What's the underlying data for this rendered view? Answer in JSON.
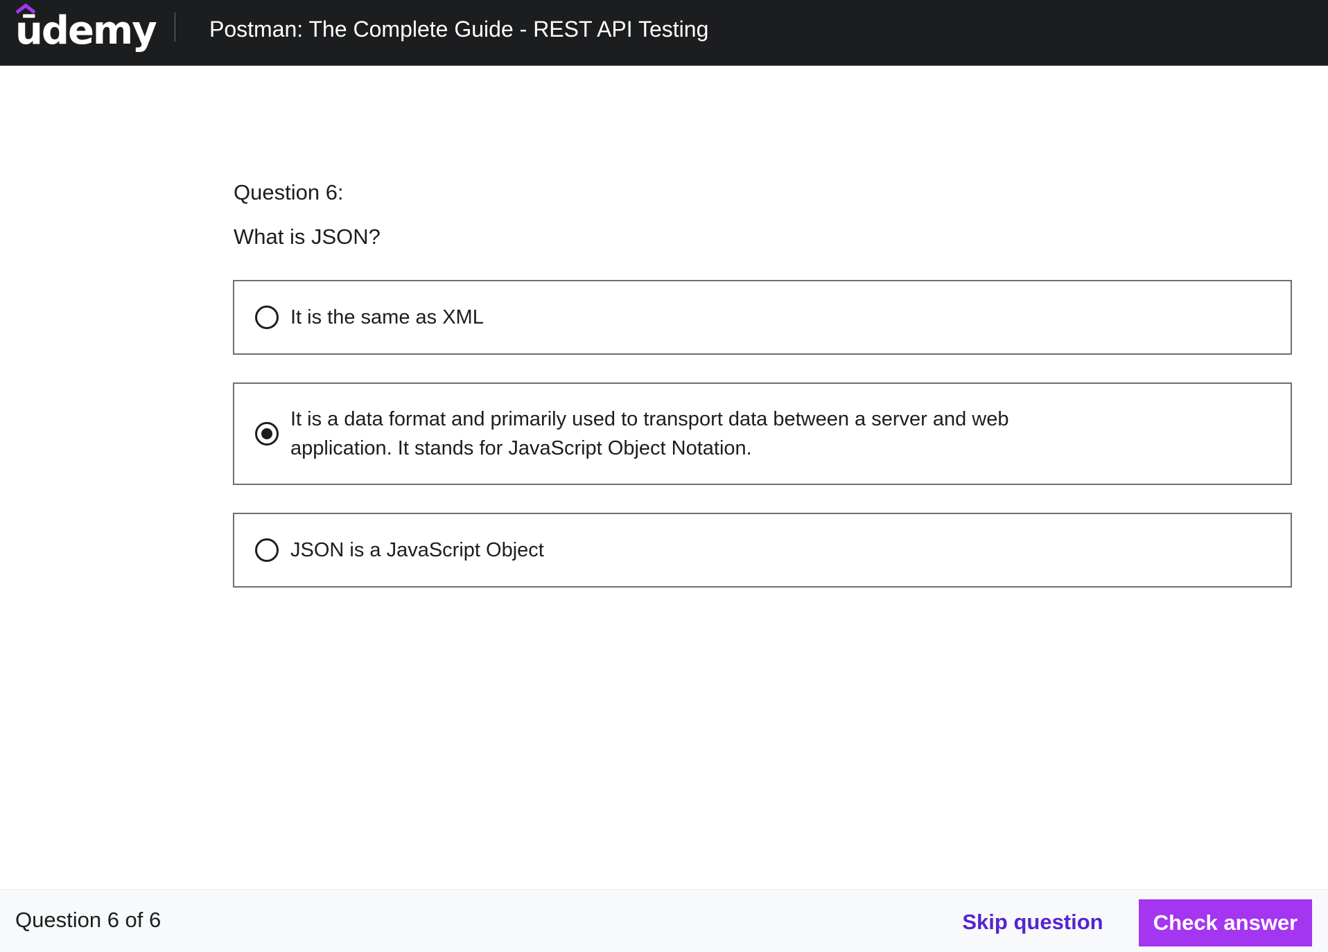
{
  "header": {
    "logo_text": "ūdemy",
    "course_title": "Postman: The Complete Guide - REST API Testing"
  },
  "quiz": {
    "question_label": "Question 6:",
    "question_text": "What is JSON?",
    "options": [
      {
        "label": "It is the same as XML",
        "selected": false
      },
      {
        "label": "It is a data format and primarily used to transport data between a server and web application. It stands for JavaScript Object Notation.",
        "selected": true
      },
      {
        "label": "JSON is a JavaScript Object",
        "selected": false
      }
    ]
  },
  "footer": {
    "progress": "Question 6 of 6",
    "skip_label": "Skip question",
    "check_label": "Check answer"
  },
  "colors": {
    "header_bg": "#1c1d1f",
    "brand_purple": "#a435f0",
    "link_purple": "#5624d0",
    "footer_bg": "#f7f9fa"
  }
}
